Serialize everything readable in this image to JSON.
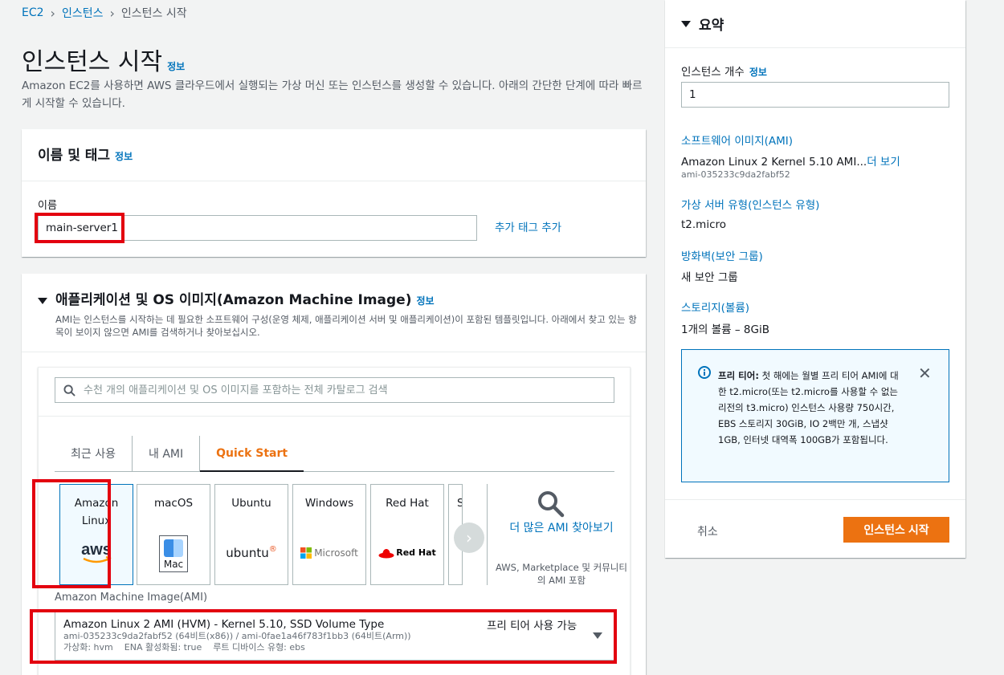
{
  "breadcrumb": {
    "root": "EC2",
    "parent": "인스턴스",
    "current": "인스턴스 시작"
  },
  "page": {
    "title": "인스턴스 시작",
    "info": "정보",
    "description": "Amazon EC2를 사용하면 AWS 클라우드에서 실행되는 가상 머신 또는 인스턴스를 생성할 수 있습니다. 아래의 간단한 단계에 따라 빠르게 시작할 수 있습니다."
  },
  "name_tags": {
    "title": "이름 및 태그",
    "info": "정보",
    "name_label": "이름",
    "name_value": "main-server1",
    "add_tag": "추가 태그 추가"
  },
  "ami": {
    "title": "애플리케이션 및 OS 이미지(Amazon Machine Image)",
    "info": "정보",
    "description": "AMI는 인스턴스를 시작하는 데 필요한 소프트웨어 구성(운영 체제, 애플리케이션 서버 및 애플리케이션)이 포함된 템플릿입니다. 아래에서 찾고 있는 항목이 보이지 않으면 AMI를 검색하거나 찾아보십시오.",
    "search_placeholder": "수천 개의 애플리케이션 및 OS 이미지를 포함하는 전체 카탈로그 검색",
    "tabs": [
      {
        "label": "최근 사용"
      },
      {
        "label": "내 AMI"
      },
      {
        "label": "Quick Start"
      }
    ],
    "os_tiles": [
      {
        "name": "Amazon Linux",
        "logo": "aws"
      },
      {
        "name": "macOS",
        "logo": "Mac"
      },
      {
        "name": "Ubuntu",
        "logo": "ubuntu"
      },
      {
        "name": "Windows",
        "logo": "Microsoft"
      },
      {
        "name": "Red Hat",
        "logo": "Red Hat"
      },
      {
        "name": "S",
        "logo": ""
      }
    ],
    "more_ami": "더 많은 AMI 찾아보기",
    "more_ami_sub": "AWS, Marketplace 및 커뮤니티의 AMI 포함",
    "select_label": "Amazon Machine Image(AMI)",
    "selected": {
      "name": "Amazon Linux 2 AMI (HVM) - Kernel 5.10, SSD Volume Type",
      "free": "프리 티어 사용 가능",
      "ids": "ami-035233c9da2fabf52 (64비트(x86)) / ami-0fae1a46f783f1bb3 (64비트(Arm))",
      "virtualization": "가상화: hvm",
      "ena": "ENA 활성화됨: true",
      "root_device": "루트 디바이스 유형: ebs"
    }
  },
  "summary": {
    "title": "요약",
    "instance_count_label": "인스턴스 개수",
    "info": "정보",
    "instance_count": "1",
    "software_image_label": "소프트웨어 이미지(AMI)",
    "software_image": "Amazon Linux 2 Kernel 5.10 AMI...",
    "more_view": "더 보기",
    "ami_id": "ami-035233c9da2fabf52",
    "instance_type_label": "가상 서버 유형(인스턴스 유형)",
    "instance_type": "t2.micro",
    "firewall_label": "방화벽(보안 그룹)",
    "firewall": "새 보안 그룹",
    "storage_label": "스토리지(볼륨)",
    "storage": "1개의 볼륨 – 8GiB",
    "free_tier_title": "프리 티어:",
    "free_tier_text": "첫 해에는 월별 프리 티어 AMI에 대한 t2.micro(또는 t2.micro를 사용할 수 없는 리전의 t3.micro) 인스턴스 사용량 750시간, EBS 스토리지 30GiB, IO 2백만 개, 스냅샷 1GB, 인터넷 대역폭 100GB가 포함됩니다.",
    "cancel": "취소",
    "launch": "인스턴스 시작"
  },
  "colors": {
    "accent": "#ec7211",
    "link": "#0073bb",
    "highlight": "#e3000f"
  }
}
